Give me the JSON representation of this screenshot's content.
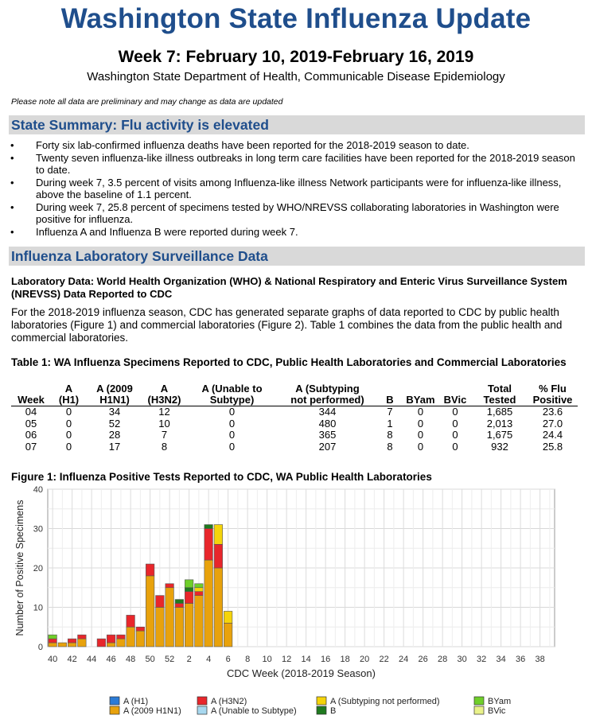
{
  "header": {
    "title": "Washington State Influenza Update",
    "week": "Week 7: February 10, 2019-February 16, 2019",
    "department": "Washington State Department of Health, Communicable Disease Epidemiology",
    "note": "Please note all data are preliminary and may change as data are updated"
  },
  "summary": {
    "heading": "State Summary: Flu activity is elevated",
    "bullets": [
      "Forty six lab-confirmed influenza deaths have been reported for the 2018-2019 season to date.",
      "Twenty seven influenza-like illness outbreaks in long term care facilities have been reported for the 2018-2019 season to date.",
      "During week 7, 3.5 percent of visits among Influenza-like illness Network participants were for influenza-like illness, above the baseline of 1.1 percent.",
      "During week 7, 25.8 percent of specimens tested by WHO/NREVSS collaborating laboratories in Washington were positive for influenza.",
      "Influenza A and Influenza B were reported during week 7."
    ]
  },
  "lab": {
    "heading": "Influenza Laboratory Surveillance Data",
    "subheading": "Laboratory Data: World Health Organization (WHO) & National Respiratory and Enteric Virus Surveillance System (NREVSS) Data Reported to CDC",
    "paragraph": "For the 2018-2019 influenza season, CDC has generated separate graphs of data reported to CDC by public health laboratories (Figure 1) and commercial laboratories (Figure 2). Table 1 combines the data from the public health and commercial laboratories."
  },
  "table1": {
    "title": "Table 1: WA Influenza Specimens Reported to CDC, Public Health Laboratories and Commercial Laboratories",
    "headers": [
      [
        "",
        "Week"
      ],
      [
        "A",
        "(H1)"
      ],
      [
        "A (2009",
        "H1N1)"
      ],
      [
        "A",
        "(H3N2)"
      ],
      [
        "A (Unable to",
        "Subtype)"
      ],
      [
        "A (Subtyping",
        "not performed)"
      ],
      [
        "",
        "B"
      ],
      [
        "",
        "BYam"
      ],
      [
        "",
        "BVic"
      ],
      [
        "Total",
        "Tested"
      ],
      [
        "% Flu",
        "Positive"
      ]
    ],
    "rows": [
      [
        "04",
        "0",
        "34",
        "12",
        "0",
        "344",
        "7",
        "0",
        "0",
        "1,685",
        "23.6"
      ],
      [
        "05",
        "0",
        "52",
        "10",
        "0",
        "480",
        "1",
        "0",
        "0",
        "2,013",
        "27.0"
      ],
      [
        "06",
        "0",
        "28",
        "7",
        "0",
        "365",
        "8",
        "0",
        "0",
        "1,675",
        "24.4"
      ],
      [
        "07",
        "0",
        "17",
        "8",
        "0",
        "207",
        "8",
        "0",
        "0",
        "932",
        "25.8"
      ]
    ]
  },
  "figure1": {
    "title": "Figure 1: Influenza Positive Tests Reported to CDC, WA Public Health Laboratories"
  },
  "chart_data": {
    "type": "bar",
    "stacked": true,
    "xlabel": "CDC Week (2018-2019 Season)",
    "ylabel": "Number of Positive Specimens",
    "ylim": [
      0,
      40
    ],
    "yticks": [
      0,
      10,
      20,
      30,
      40
    ],
    "categories": [
      "40",
      "41",
      "42",
      "43",
      "44",
      "45",
      "46",
      "47",
      "48",
      "49",
      "50",
      "51",
      "52",
      "1",
      "2",
      "3",
      "4",
      "5",
      "6",
      "7",
      "8",
      "9",
      "10",
      "11",
      "12",
      "13",
      "14",
      "15",
      "16",
      "17",
      "18",
      "19",
      "20",
      "21",
      "22",
      "23",
      "24",
      "25",
      "26",
      "27",
      "28",
      "29",
      "30",
      "31",
      "32",
      "33",
      "34",
      "35",
      "36",
      "37",
      "38",
      "39"
    ],
    "xtick_labels": [
      "40",
      "42",
      "44",
      "46",
      "48",
      "50",
      "52",
      "2",
      "4",
      "6",
      "8",
      "10",
      "12",
      "14",
      "16",
      "18",
      "20",
      "22",
      "24",
      "26",
      "28",
      "30",
      "32",
      "34",
      "36",
      "38"
    ],
    "grid": true,
    "legend_position": "bottom",
    "series": [
      {
        "name": "A (H1)",
        "color": "#2b7bd6",
        "values": [
          0,
          0,
          0,
          0,
          0,
          0,
          0,
          0,
          0,
          0,
          0,
          0,
          0,
          0,
          0,
          0,
          0,
          0,
          0,
          0,
          0,
          0,
          0,
          0,
          0,
          0,
          0,
          0,
          0,
          0,
          0,
          0,
          0,
          0,
          0,
          0,
          0,
          0,
          0,
          0,
          0,
          0,
          0,
          0,
          0,
          0,
          0,
          0,
          0,
          0,
          0,
          0
        ]
      },
      {
        "name": "A (2009 H1N1)",
        "color": "#e8a20c",
        "values": [
          1,
          1,
          1,
          2,
          0,
          0,
          1,
          2,
          5,
          4,
          18,
          10,
          15,
          10,
          11,
          13,
          22,
          20,
          6,
          0,
          0,
          0,
          0,
          0,
          0,
          0,
          0,
          0,
          0,
          0,
          0,
          0,
          0,
          0,
          0,
          0,
          0,
          0,
          0,
          0,
          0,
          0,
          0,
          0,
          0,
          0,
          0,
          0,
          0,
          0,
          0,
          0
        ]
      },
      {
        "name": "A (H3N2)",
        "color": "#e8262b",
        "values": [
          1,
          0,
          1,
          1,
          0,
          2,
          2,
          1,
          3,
          1,
          3,
          3,
          1,
          1,
          3,
          1,
          8,
          6,
          0,
          0,
          0,
          0,
          0,
          0,
          0,
          0,
          0,
          0,
          0,
          0,
          0,
          0,
          0,
          0,
          0,
          0,
          0,
          0,
          0,
          0,
          0,
          0,
          0,
          0,
          0,
          0,
          0,
          0,
          0,
          0,
          0,
          0
        ]
      },
      {
        "name": "A (Unable to Subtype)",
        "color": "#a8d8ef",
        "values": [
          0,
          0,
          0,
          0,
          0,
          0,
          0,
          0,
          0,
          0,
          0,
          0,
          0,
          0,
          0,
          0,
          0,
          0,
          0,
          0,
          0,
          0,
          0,
          0,
          0,
          0,
          0,
          0,
          0,
          0,
          0,
          0,
          0,
          0,
          0,
          0,
          0,
          0,
          0,
          0,
          0,
          0,
          0,
          0,
          0,
          0,
          0,
          0,
          0,
          0,
          0,
          0
        ]
      },
      {
        "name": "A (Subtyping not performed)",
        "color": "#f5d40a",
        "values": [
          0,
          0,
          0,
          0,
          0,
          0,
          0,
          0,
          0,
          0,
          0,
          0,
          0,
          0,
          0,
          1,
          0,
          5,
          3,
          0,
          0,
          0,
          0,
          0,
          0,
          0,
          0,
          0,
          0,
          0,
          0,
          0,
          0,
          0,
          0,
          0,
          0,
          0,
          0,
          0,
          0,
          0,
          0,
          0,
          0,
          0,
          0,
          0,
          0,
          0,
          0,
          0
        ]
      },
      {
        "name": "B",
        "color": "#1f7a1f",
        "values": [
          0,
          0,
          0,
          0,
          0,
          0,
          0,
          0,
          0,
          0,
          0,
          0,
          0,
          1,
          1,
          0,
          1,
          0,
          0,
          0,
          0,
          0,
          0,
          0,
          0,
          0,
          0,
          0,
          0,
          0,
          0,
          0,
          0,
          0,
          0,
          0,
          0,
          0,
          0,
          0,
          0,
          0,
          0,
          0,
          0,
          0,
          0,
          0,
          0,
          0,
          0,
          0
        ]
      },
      {
        "name": "BYam",
        "color": "#6fcf2a",
        "values": [
          1,
          0,
          0,
          0,
          0,
          0,
          0,
          0,
          0,
          0,
          0,
          0,
          0,
          0,
          2,
          1,
          0,
          0,
          0,
          0,
          0,
          0,
          0,
          0,
          0,
          0,
          0,
          0,
          0,
          0,
          0,
          0,
          0,
          0,
          0,
          0,
          0,
          0,
          0,
          0,
          0,
          0,
          0,
          0,
          0,
          0,
          0,
          0,
          0,
          0,
          0,
          0
        ]
      },
      {
        "name": "BVic",
        "color": "#e9f28a",
        "values": [
          0,
          0,
          0,
          0,
          0,
          0,
          0,
          0,
          0,
          0,
          0,
          0,
          0,
          0,
          0,
          0,
          0,
          0,
          0,
          0,
          0,
          0,
          0,
          0,
          0,
          0,
          0,
          0,
          0,
          0,
          0,
          0,
          0,
          0,
          0,
          0,
          0,
          0,
          0,
          0,
          0,
          0,
          0,
          0,
          0,
          0,
          0,
          0,
          0,
          0,
          0,
          0
        ]
      }
    ],
    "legend_order": [
      "A (H1)",
      "A (2009 H1N1)",
      "A (H3N2)",
      "A (Unable to Subtype)",
      "A (Subtyping not performed)",
      "B",
      "BYam",
      "BVic"
    ]
  }
}
